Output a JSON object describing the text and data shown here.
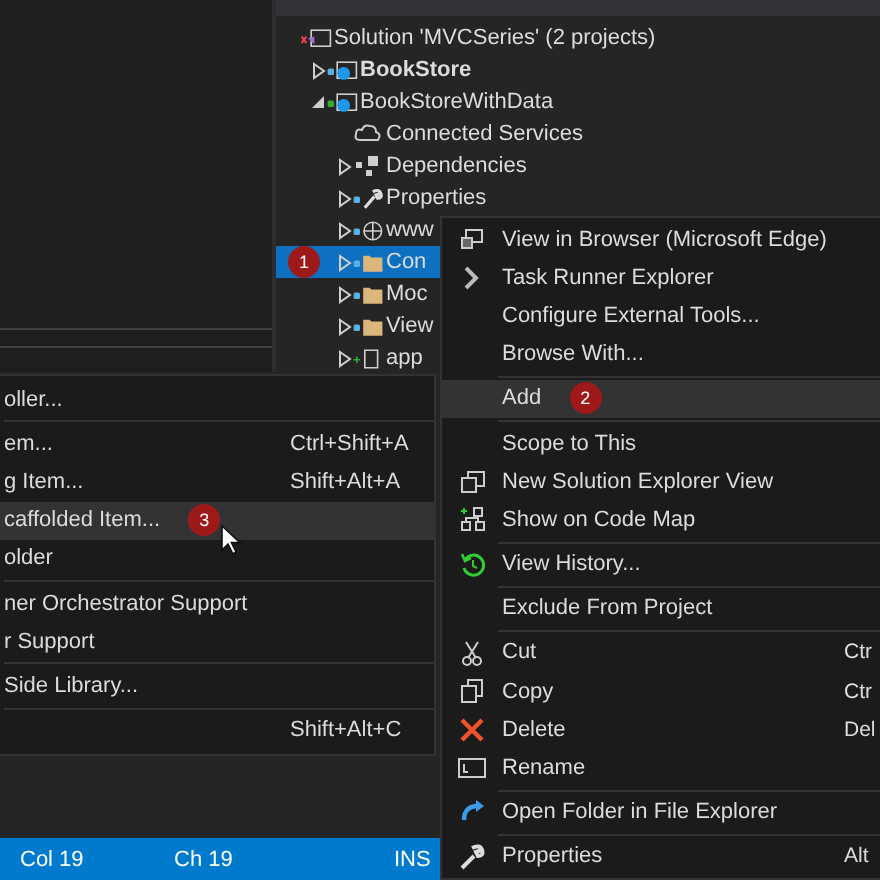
{
  "solution_explorer": {
    "tree": [
      {
        "label": "Solution 'MVCSeries' (2 projects)",
        "kind": "solution",
        "selected": false,
        "children": [
          {
            "label": "BookStore",
            "kind": "project",
            "bold": true,
            "expanded": false,
            "selected": false
          },
          {
            "label": "BookStoreWithData",
            "kind": "project",
            "bold": false,
            "expanded": true,
            "selected": false,
            "children": [
              {
                "label": "Connected Services",
                "kind": "cloud",
                "selected": false
              },
              {
                "label": "Dependencies",
                "kind": "deps",
                "expanded": false,
                "selected": false
              },
              {
                "label": "Properties",
                "kind": "wrench",
                "expanded": false,
                "selected": false
              },
              {
                "label": "www",
                "kind": "globe",
                "expanded": false,
                "selected": false
              },
              {
                "label": "Con",
                "kind": "folder",
                "expanded": false,
                "selected": true,
                "badge": "1"
              },
              {
                "label": "Moc",
                "kind": "folder",
                "expanded": false,
                "selected": false
              },
              {
                "label": "View",
                "kind": "folder",
                "expanded": false,
                "selected": false
              },
              {
                "label": "app",
                "kind": "file",
                "expanded": false,
                "selected": false
              }
            ]
          }
        ]
      }
    ]
  },
  "context_menu": {
    "items": [
      {
        "kind": "item",
        "label": "View in Browser (Microsoft Edge)",
        "selected": false
      },
      {
        "kind": "item",
        "label": "Task Runner Explorer",
        "selected": false
      },
      {
        "kind": "item",
        "label": "Configure External Tools...",
        "selected": false
      },
      {
        "kind": "item",
        "label": "Browse With...",
        "selected": false
      },
      {
        "kind": "separator"
      },
      {
        "kind": "item",
        "label": "Add",
        "selected": true,
        "badge": "2"
      },
      {
        "kind": "separator"
      },
      {
        "kind": "item",
        "label": "Scope to This",
        "selected": false
      },
      {
        "kind": "item",
        "label": "New Solution Explorer View",
        "selected": false
      },
      {
        "kind": "item",
        "label": "Show on Code Map",
        "selected": false
      },
      {
        "kind": "separator"
      },
      {
        "kind": "item",
        "label": "View History...",
        "selected": false
      },
      {
        "kind": "separator"
      },
      {
        "kind": "item",
        "label": "Exclude From Project",
        "selected": false
      },
      {
        "kind": "separator"
      },
      {
        "kind": "item",
        "label": "Cut",
        "shortcut": "Ctr",
        "selected": false
      },
      {
        "kind": "item",
        "label": "Copy",
        "shortcut": "Ctr",
        "selected": false
      },
      {
        "kind": "item",
        "label": "Delete",
        "shortcut": "Del",
        "selected": false
      },
      {
        "kind": "item",
        "label": "Rename",
        "selected": false
      },
      {
        "kind": "separator"
      },
      {
        "kind": "item",
        "label": "Open Folder in File Explorer",
        "selected": false
      },
      {
        "kind": "separator"
      },
      {
        "kind": "item",
        "label": "Properties",
        "shortcut": "Alt",
        "selected": false
      }
    ]
  },
  "add_submenu": {
    "items": [
      {
        "kind": "item",
        "label": "oller...",
        "selected": false
      },
      {
        "kind": "separator"
      },
      {
        "kind": "item",
        "label": "em...",
        "shortcut": "Ctrl+Shift+A",
        "selected": false
      },
      {
        "kind": "item",
        "label": "g Item...",
        "shortcut": "Shift+Alt+A",
        "selected": false
      },
      {
        "kind": "item",
        "label": "caffolded Item...",
        "selected": true,
        "badge": "3"
      },
      {
        "kind": "item",
        "label": "older",
        "selected": false
      },
      {
        "kind": "separator"
      },
      {
        "kind": "item",
        "label": "ner Orchestrator Support",
        "selected": false
      },
      {
        "kind": "item",
        "label": "r Support",
        "selected": false
      },
      {
        "kind": "separator"
      },
      {
        "kind": "item",
        "label": "Side Library...",
        "selected": false
      },
      {
        "kind": "separator"
      },
      {
        "kind": "item",
        "shortcut": "Shift+Alt+C",
        "selected": false
      }
    ]
  },
  "status_bar": {
    "items": [
      "Col 19",
      "Ch 19",
      "INS"
    ]
  }
}
